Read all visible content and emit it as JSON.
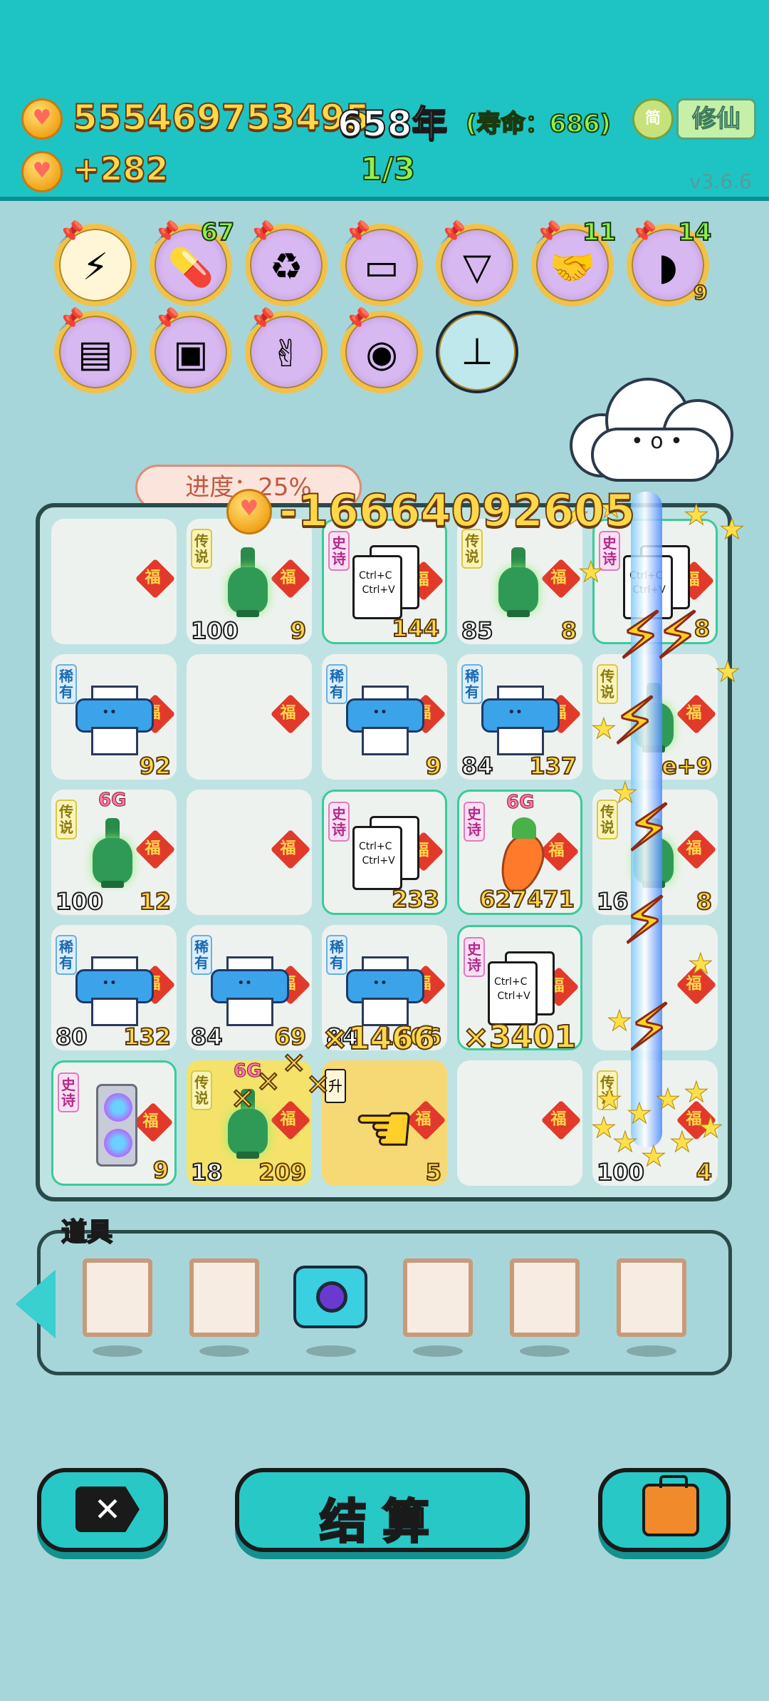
{
  "header": {
    "coins": "555469753495",
    "year": "658年",
    "lifespan": "(寿命：686)",
    "income": "+282",
    "round": "1/3",
    "lang_badge": "简",
    "mode_button": "修仙",
    "version": "v3.6.6"
  },
  "relics": [
    {
      "icon": "lightning-icon",
      "count": ""
    },
    {
      "icon": "pill-box-icon",
      "count": "67"
    },
    {
      "icon": "recycle-icon",
      "count": ""
    },
    {
      "icon": "tissue-box-icon",
      "count": ""
    },
    {
      "icon": "skirt-icon",
      "count": ""
    },
    {
      "icon": "handshake-icon",
      "count": "11"
    },
    {
      "icon": "shell-icon",
      "count": "14",
      "sub": "9"
    },
    {
      "icon": "printer-icon",
      "count": ""
    },
    {
      "icon": "time-magazine-icon",
      "count": ""
    },
    {
      "icon": "rock-hand-icon",
      "count": ""
    },
    {
      "icon": "rgb-icon",
      "count": ""
    },
    {
      "icon": "pump-icon",
      "count": ""
    }
  ],
  "progress": {
    "label": "进度：25%",
    "float_change": "-16664092605"
  },
  "board": {
    "fu": "福",
    "rows": [
      [
        {
          "item": "",
          "rarity": "",
          "left": "",
          "right": ""
        },
        {
          "item": "vase",
          "rarity": "传说",
          "left": "100",
          "right": "9"
        },
        {
          "item": "copy",
          "rarity": "史诗",
          "left": "",
          "right": "144"
        },
        {
          "item": "vase",
          "rarity": "传说",
          "left": "85",
          "right": "8"
        },
        {
          "item": "copy",
          "rarity": "史诗",
          "left": "",
          "right": "8"
        }
      ],
      [
        {
          "item": "printer",
          "rarity": "稀有",
          "left": "",
          "right": "92"
        },
        {
          "item": "",
          "rarity": "",
          "left": "",
          "right": ""
        },
        {
          "item": "printer",
          "rarity": "稀有",
          "left": "",
          "right": "9"
        },
        {
          "item": "printer",
          "rarity": "稀有",
          "left": "84",
          "right": "137"
        },
        {
          "item": "vase",
          "rarity": "传说",
          "left": "",
          "right": "e+9"
        }
      ],
      [
        {
          "item": "vase",
          "rarity": "传说",
          "tag": "6G",
          "left": "100",
          "right": "12"
        },
        {
          "item": "",
          "rarity": "",
          "left": "",
          "right": ""
        },
        {
          "item": "copy",
          "rarity": "史诗",
          "left": "",
          "right": "233"
        },
        {
          "item": "carrot",
          "rarity": "史诗",
          "tag": "6G",
          "left": "",
          "right": "627471"
        },
        {
          "item": "vase",
          "rarity": "传说",
          "left": "16",
          "right": "8"
        }
      ],
      [
        {
          "item": "printer",
          "rarity": "稀有",
          "left": "80",
          "right": "132"
        },
        {
          "item": "printer",
          "rarity": "稀有",
          "left": "84",
          "right": "69"
        },
        {
          "item": "printer",
          "rarity": "稀有",
          "left": "84",
          "right": "1466"
        },
        {
          "item": "copy",
          "rarity": "史诗",
          "left": "",
          "right": ""
        },
        {
          "item": "",
          "rarity": "",
          "left": "",
          "right": ""
        }
      ],
      [
        {
          "item": "gpu",
          "rarity": "史诗",
          "left": "",
          "right": "9"
        },
        {
          "item": "vase",
          "rarity": "传说",
          "tag": "6G",
          "left": "18",
          "right": "209"
        },
        {
          "item": "hand",
          "rarity": "",
          "left": "",
          "right": "5"
        },
        {
          "item": "",
          "rarity": "",
          "left": "",
          "right": ""
        },
        {
          "item": "",
          "rarity": "传说",
          "left": "100",
          "right": "4"
        }
      ]
    ],
    "multipliers": [
      "×1466",
      "×3401"
    ],
    "upgrade_tag": "升"
  },
  "props": {
    "title": "道具",
    "slots": [
      "",
      "",
      "camera",
      "",
      "",
      ""
    ]
  },
  "buttons": {
    "cancel_icon": "close-tag-icon",
    "settle": "结算",
    "bag_icon": "briefcase-icon"
  },
  "colors": {
    "header": "#1ec4c3",
    "background": "#a7d6da",
    "gold": "#ffd84a",
    "accent_green": "#8ff04a"
  }
}
